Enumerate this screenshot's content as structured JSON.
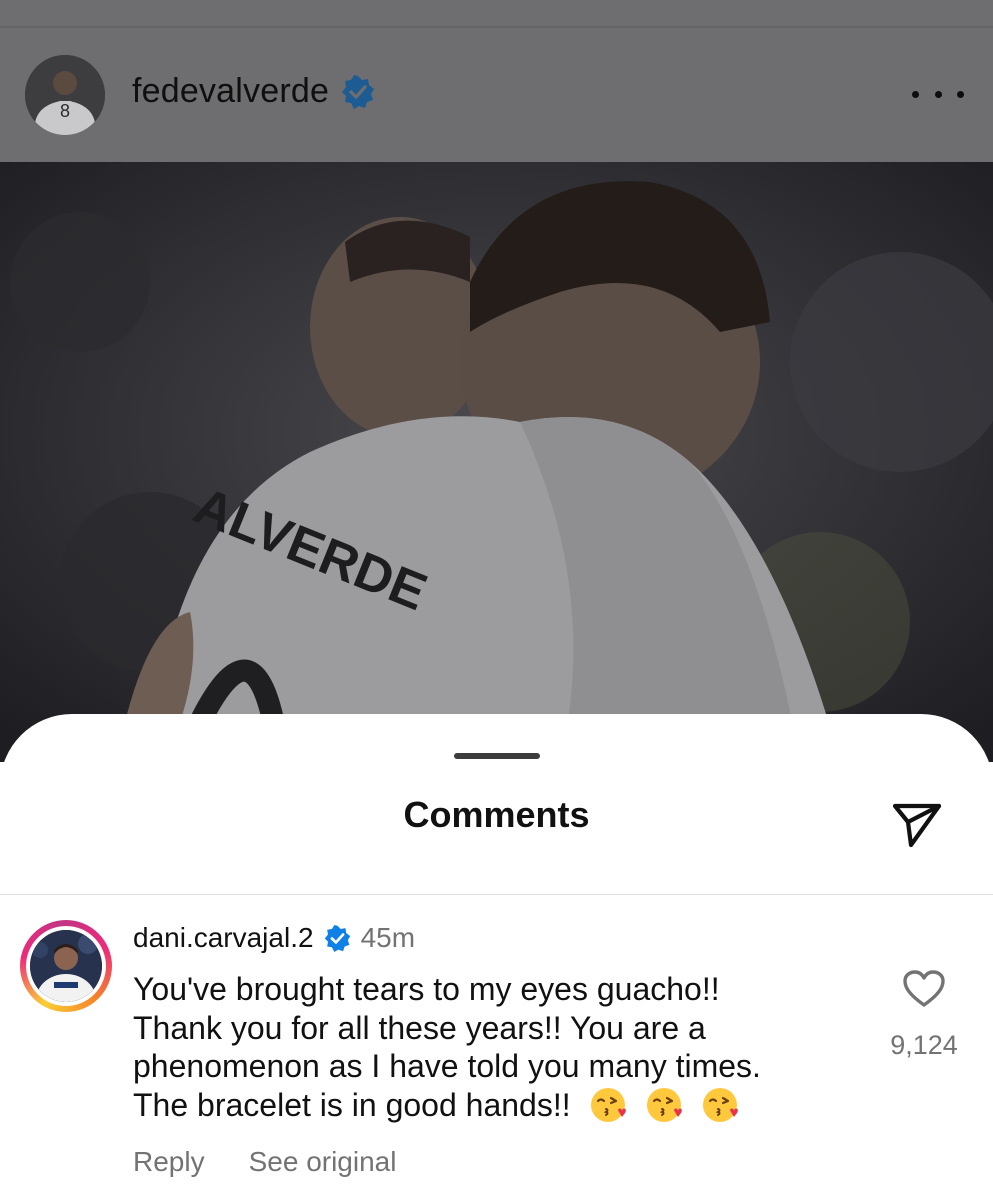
{
  "post": {
    "author": "fedevalverde",
    "author_verified": true,
    "more_icon": "more-horizontal-icon",
    "photo_jersey_text": "ALVERDE"
  },
  "comments_sheet": {
    "title": "Comments",
    "share_icon": "send-icon"
  },
  "comment": {
    "username": "dani.carvajal.2",
    "verified": true,
    "time": "45m",
    "lines": [
      "You've brought tears to my eyes guacho!!",
      "Thank you for all these years!! You are a",
      "phenomenon as I have told you many times.",
      "The bracelet is in good hands!!"
    ],
    "emojis": [
      "kissing-face-with-heart",
      "kissing-face-with-heart",
      "kissing-face-with-heart"
    ],
    "like_icon": "heart-outline-icon",
    "like_count": "9,124",
    "reply_label": "Reply",
    "see_original_label": "See original"
  },
  "colors": {
    "verified_blue": "#1d5c92",
    "dim_overlay": "#6e6e70",
    "secondary_text": "#737373"
  }
}
